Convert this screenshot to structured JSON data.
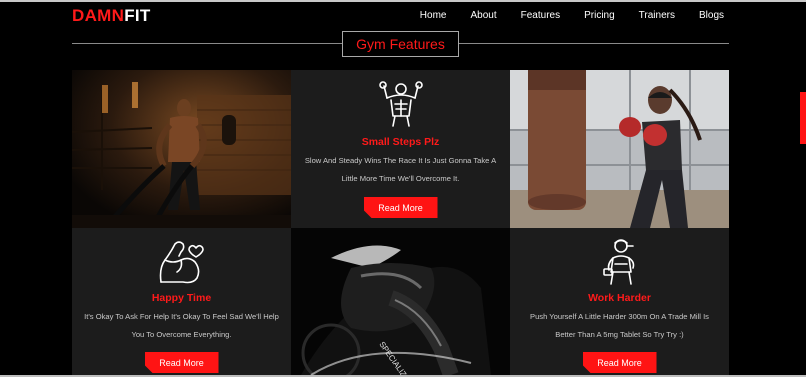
{
  "brand": {
    "logo_accent": "DAMN",
    "logo_rest": "FIT",
    "accent_color": "#ff1a1a"
  },
  "nav": {
    "items": [
      "Home",
      "About",
      "Features",
      "Pricing",
      "Trainers",
      "Blogs"
    ]
  },
  "section": {
    "title": "Gym Features"
  },
  "cards": [
    {
      "icon": "bodybuilder-icon",
      "title": "Small Steps Plz",
      "text": "Slow And Steady Wins The Race It Is Just Gonna Take A Little More Time We'll Overcome It.",
      "button": "Read More"
    },
    {
      "icon": "flexed-arm-heart-icon",
      "title": "Happy Time",
      "text": "It's Okay To Ask For Help It's Okay To Feel Sad We'll Help You To Overcome Everything.",
      "button": "Read More"
    },
    {
      "icon": "fitness-woman-icon",
      "title": "Work Harder",
      "text": "Push Yourself A Little Harder 300m On A Trade Mill Is Better Than A 5mg Tablet So Try Try :)",
      "button": "Read More"
    }
  ],
  "photos": [
    {
      "name": "battle-ropes-photo"
    },
    {
      "name": "boxing-woman-photo"
    },
    {
      "name": "cyclist-photo",
      "jersey_text": "SPECIALIZED"
    }
  ]
}
